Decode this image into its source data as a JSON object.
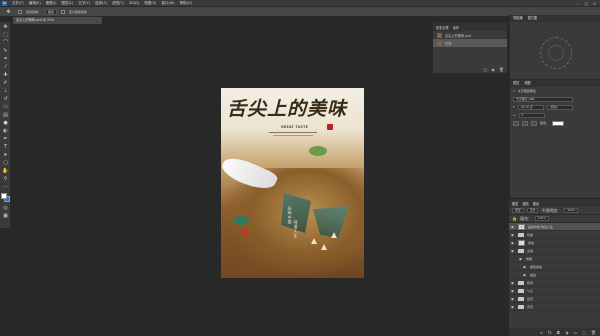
{
  "menubar": {
    "app_badge": "Ps",
    "items": [
      "文件(F)",
      "编辑(E)",
      "图像(I)",
      "图层(L)",
      "文字(Y)",
      "选择(S)",
      "滤镜(T)",
      "3D(D)",
      "视图(V)",
      "窗口(W)",
      "帮助(H)"
    ],
    "minimize": "–",
    "maximize": "□",
    "close": "×"
  },
  "options": {
    "auto_select_label": "自动选择：",
    "auto_select_value": "图层",
    "transform_label": "显示变换控件"
  },
  "document_tab": "舌尖上的美味.psd @ 25%",
  "poster": {
    "title": "舌尖上的美味",
    "subtitle": "GREAT TASTE",
    "vertical_text_1": "品味中国",
    "vertical_text_2": "味道人生"
  },
  "history_panel": {
    "tabs": [
      "历史记录",
      "动作"
    ],
    "rows": [
      {
        "label": "舌尖上的美味.psd"
      },
      {
        "label": "打开"
      }
    ]
  },
  "navigator": {
    "tabs": [
      "导航器",
      "直方图"
    ]
  },
  "properties": {
    "tabs": [
      "属性",
      "调整"
    ],
    "heading": "文字图层属性",
    "font": "方正粗黑_GBK",
    "size": "24.15 点",
    "leading": "(自动)",
    "tracking": "0",
    "color_label": "颜色："
  },
  "layers_panel": {
    "tabs": [
      "图层",
      "通道",
      "路径"
    ],
    "kind_label": "类型",
    "mode": "正常",
    "opacity_label": "不透明度：",
    "opacity": "100%",
    "fill_label": "填充：",
    "fill": "100%",
    "layers": [
      {
        "name": "品味中国 味道人生",
        "type": "text",
        "visible": true,
        "selected": true
      },
      {
        "name": "印章",
        "type": "folder",
        "visible": true
      },
      {
        "name": "青瓷",
        "type": "layer",
        "visible": true
      },
      {
        "name": "文案",
        "type": "folder",
        "visible": true
      },
      {
        "name": "效果",
        "type": "layer",
        "visible": true
      },
      {
        "name": "颜色叠加",
        "type": "layer",
        "visible": true
      },
      {
        "name": "描边",
        "type": "layer",
        "visible": true
      },
      {
        "name": "装饰",
        "type": "folder",
        "visible": true
      },
      {
        "name": "勺子",
        "type": "folder",
        "visible": true
      },
      {
        "name": "远景",
        "type": "folder",
        "visible": true
      },
      {
        "name": "背景",
        "type": "folder",
        "visible": true
      }
    ]
  },
  "colors": {
    "foreground": "#ffffff",
    "background": "#2b6fc2"
  }
}
